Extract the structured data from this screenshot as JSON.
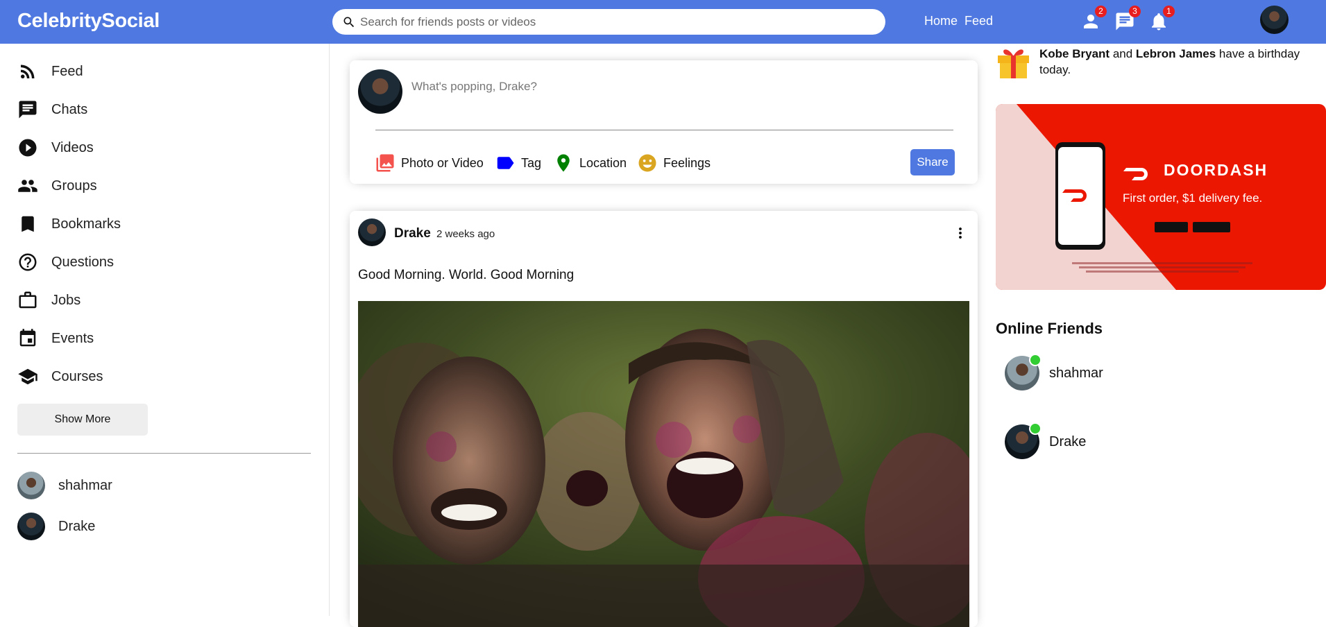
{
  "topbar": {
    "logo": "CelebritySocial",
    "search_placeholder": "Search for friends posts or videos",
    "links": [
      "Home",
      "Feed"
    ],
    "icons": [
      {
        "name": "person-icon",
        "badge": "2"
      },
      {
        "name": "chat-icon",
        "badge": "3"
      },
      {
        "name": "bell-icon",
        "badge": "1"
      }
    ]
  },
  "sidebar": {
    "items": [
      {
        "label": "Feed",
        "icon": "rss-feed-icon"
      },
      {
        "label": "Chats",
        "icon": "chat-icon"
      },
      {
        "label": "Videos",
        "icon": "play-circle-icon"
      },
      {
        "label": "Groups",
        "icon": "group-icon"
      },
      {
        "label": "Bookmarks",
        "icon": "bookmark-icon"
      },
      {
        "label": "Questions",
        "icon": "help-circle-icon"
      },
      {
        "label": "Jobs",
        "icon": "briefcase-icon"
      },
      {
        "label": "Events",
        "icon": "calendar-icon"
      },
      {
        "label": "Courses",
        "icon": "school-icon"
      }
    ],
    "show_more": "Show More",
    "friends": [
      "shahmar",
      "Drake"
    ]
  },
  "share": {
    "placeholder": "What's popping, Drake?",
    "options": [
      {
        "label": "Photo or Video",
        "icon": "photo-library-icon",
        "color": "#f4524d"
      },
      {
        "label": "Tag",
        "icon": "label-icon",
        "color": "#0000ff"
      },
      {
        "label": "Location",
        "icon": "location-pin-icon",
        "color": "#008000"
      },
      {
        "label": "Feelings",
        "icon": "emoji-icon",
        "color": "#daa520"
      }
    ],
    "button": "Share"
  },
  "post": {
    "username": "Drake",
    "date": "2 weeks ago",
    "text": "Good Morning. World. Good Morning"
  },
  "rightbar": {
    "birthday": {
      "name1": "Kobe Bryant",
      "and": "and",
      "name2": "Lebron James",
      "suffix": "have a birthday today."
    },
    "ad": {
      "brand": "DOORDASH",
      "tagline": "First order, $1 delivery fee."
    },
    "online_title": "Online Friends",
    "online_friends": [
      "shahmar",
      "Drake"
    ]
  },
  "colors": {
    "primary": "#4f79e0",
    "badge": "#e81e1e",
    "online": "#32cd32",
    "ad_red": "#eb1700"
  }
}
